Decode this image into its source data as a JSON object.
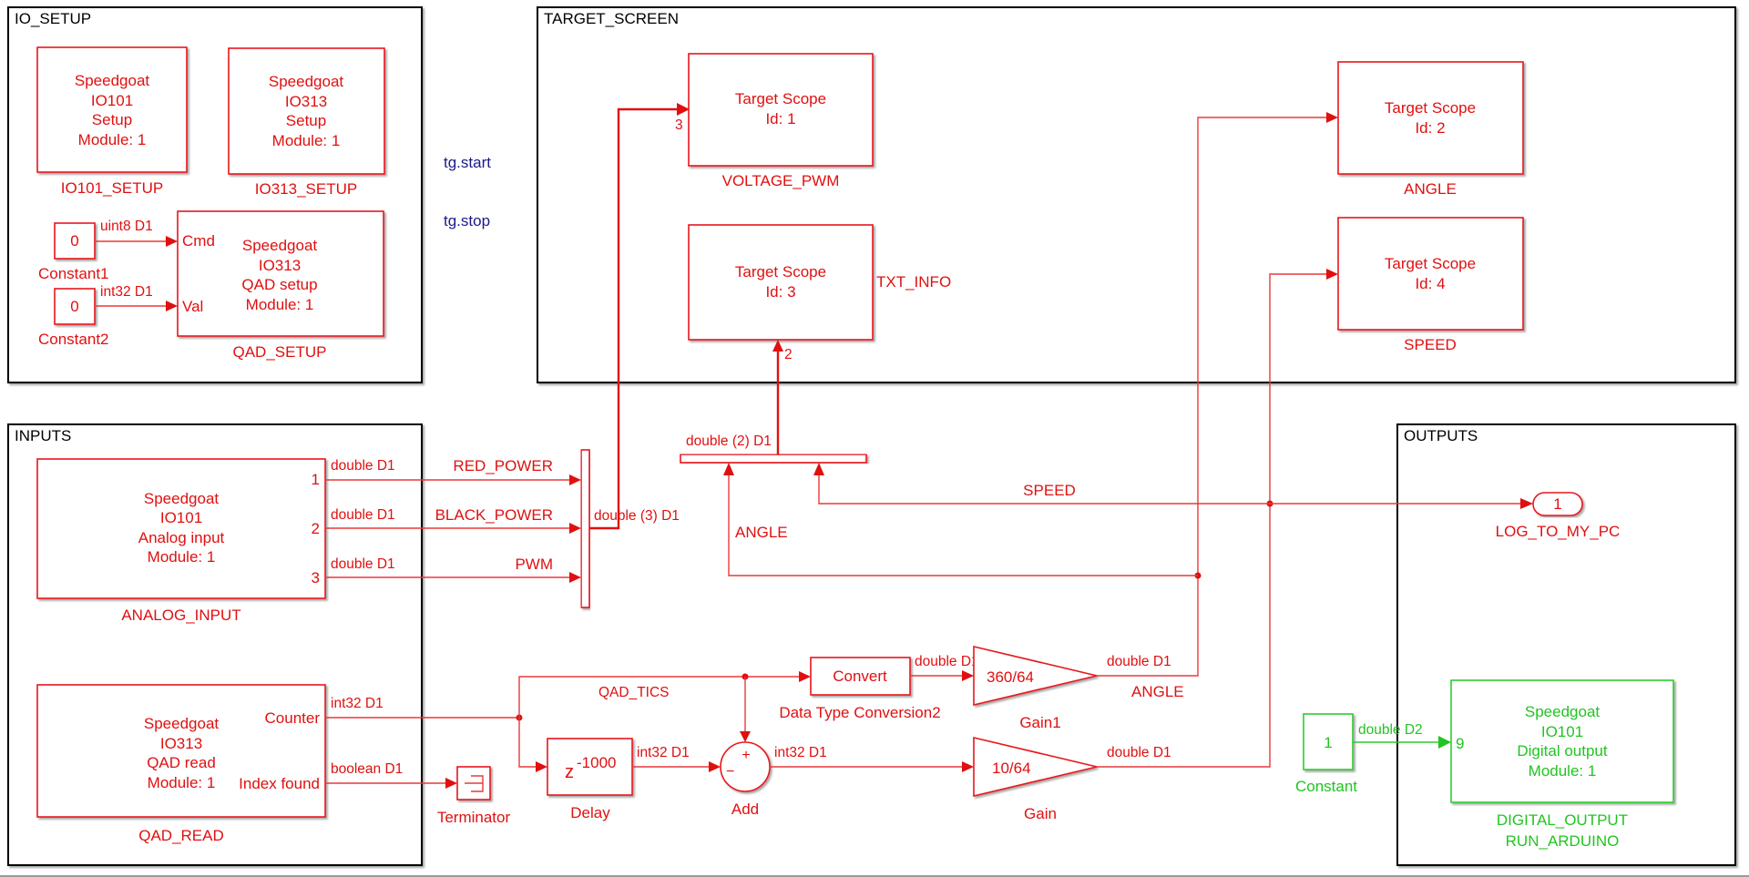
{
  "areas": {
    "io_setup": "IO_SETUP",
    "target_screen": "TARGET_SCREEN",
    "inputs": "INPUTS",
    "outputs": "OUTPUTS"
  },
  "blocks": {
    "io101_setup": {
      "lines": [
        "Speedgoat",
        "IO101",
        "Setup",
        "Module: 1"
      ],
      "name": "IO101_SETUP"
    },
    "io313_setup": {
      "lines": [
        "Speedgoat",
        "IO313",
        "Setup",
        "Module: 1"
      ],
      "name": "IO313_SETUP"
    },
    "qad_setup": {
      "lines": [
        "Speedgoat",
        "IO313",
        "QAD setup",
        "Module: 1"
      ],
      "name": "QAD_SETUP",
      "ports": [
        "Cmd",
        "Val"
      ]
    },
    "constant1": {
      "value": "0",
      "name": "Constant1",
      "signal": "uint8 D1"
    },
    "constant2": {
      "value": "0",
      "name": "Constant2",
      "signal": "int32 D1"
    },
    "scope1": {
      "lines": [
        "Target Scope",
        "Id: 1"
      ],
      "name": "VOLTAGE_PWM",
      "port": "3"
    },
    "scope3": {
      "lines": [
        "Target Scope",
        "Id: 3"
      ],
      "name": "TXT_INFO",
      "port": "2"
    },
    "scope2": {
      "lines": [
        "Target Scope",
        "Id: 2"
      ],
      "name": "ANGLE"
    },
    "scope4": {
      "lines": [
        "Target Scope",
        "Id: 4"
      ],
      "name": "SPEED"
    },
    "analog_input": {
      "lines": [
        "Speedgoat",
        "IO101",
        "Analog input",
        "Module: 1"
      ],
      "name": "ANALOG_INPUT",
      "ports": [
        "1",
        "2",
        "3"
      ]
    },
    "qad_read": {
      "lines": [
        "Speedgoat",
        "IO313",
        "QAD read",
        "Module: 1"
      ],
      "name": "QAD_READ",
      "ports": [
        "Counter",
        "Index found"
      ]
    },
    "terminator": {
      "name": "Terminator"
    },
    "delay": {
      "base": "z",
      "exponent": "-1000",
      "name": "Delay"
    },
    "add": {
      "name": "Add",
      "plus": "+",
      "minus": "−"
    },
    "convert": {
      "label": "Convert",
      "name": "Data Type Conversion2"
    },
    "gain1": {
      "value": "360/64",
      "name": "Gain1"
    },
    "gain": {
      "value": "10/64",
      "name": "Gain"
    },
    "outport": {
      "value": "1",
      "name": "LOG_TO_MY_PC"
    },
    "constant": {
      "value": "1",
      "name": "Constant"
    },
    "digital_output": {
      "lines": [
        "Speedgoat",
        "IO101",
        "Digital output",
        "Module: 1"
      ],
      "name_lines": [
        "DIGITAL_OUTPUT",
        "RUN_ARDUINO"
      ],
      "port": "9"
    }
  },
  "callbacks": {
    "start": "tg.start",
    "stop": "tg.stop"
  },
  "signals": {
    "ai1_type": "double D1",
    "ai2_type": "double D1",
    "ai3_type": "double D1",
    "red_power": "RED_POWER",
    "black_power": "BLACK_POWER",
    "pwm": "PWM",
    "mux3_out": "double (3) D1",
    "mux2_out": "double (2) D1",
    "speed": "SPEED",
    "angle_fb": "ANGLE",
    "counter_type": "int32 D1",
    "index_type": "boolean D1",
    "qad_tics": "QAD_TICS",
    "convert_out": "double D1",
    "delay_out": "int32 D1",
    "add_out": "int32 D1",
    "gain1_out_type": "double D1",
    "gain1_out_name": "ANGLE",
    "gain_out_type": "double D1",
    "constant_out": "double D2"
  },
  "colors": {
    "block_red": "#e01010",
    "block_green": "#22c422",
    "callback_blue": "#1a1a8c"
  }
}
